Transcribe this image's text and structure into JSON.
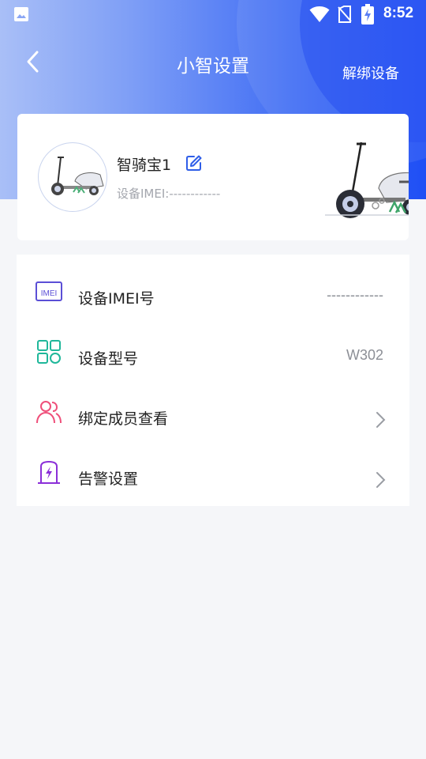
{
  "status_bar": {
    "time": "8:52",
    "icons": [
      "gallery-icon",
      "wifi-icon",
      "no-sim-icon",
      "battery-charging-icon"
    ]
  },
  "nav": {
    "title": "小智设置",
    "back_icon": "chevron-left-icon",
    "unbind_label": "解绑设备"
  },
  "device": {
    "name": "智骑宝1",
    "imei_text": "设备IMEI:------------",
    "edit_icon": "edit-icon"
  },
  "settings": {
    "items": [
      {
        "label": "设备IMEI号",
        "value": "------------",
        "icon": "imei-icon",
        "has_chevron": false
      },
      {
        "label": "设备型号",
        "value": "W302",
        "icon": "grid-icon",
        "has_chevron": false
      },
      {
        "label": "绑定成员查看",
        "value": "",
        "icon": "members-icon",
        "has_chevron": true
      },
      {
        "label": "告警设置",
        "value": "",
        "icon": "battery-alert-icon",
        "has_chevron": true
      }
    ]
  },
  "colors": {
    "header_start": "#a9bff7",
    "header_end": "#1f4ff5",
    "accent": "#2f5ee8",
    "imei_icon": "#5b4fd6",
    "grid_icon": "#1fb79a",
    "members_icon": "#ef4f7a",
    "alert_icon": "#8b2fd8"
  }
}
